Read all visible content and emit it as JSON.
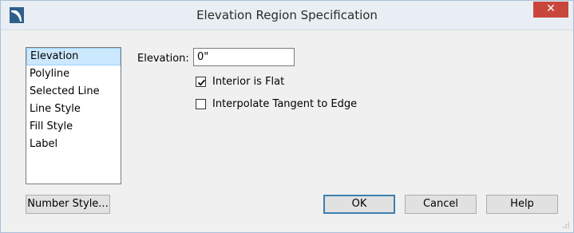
{
  "window": {
    "title": "Elevation Region Specification",
    "close_glyph": "✕",
    "app_icon": "app-logo-icon"
  },
  "sidebar": {
    "items": [
      {
        "label": "Elevation",
        "selected": true
      },
      {
        "label": "Polyline",
        "selected": false
      },
      {
        "label": "Selected Line",
        "selected": false
      },
      {
        "label": "Line Style",
        "selected": false
      },
      {
        "label": "Fill Style",
        "selected": false
      },
      {
        "label": "Label",
        "selected": false
      }
    ]
  },
  "form": {
    "elevation_label": "Elevation:",
    "elevation_value": "0\"",
    "interior_flat": {
      "label": "Interior is Flat",
      "checked": true
    },
    "interpolate_tangent": {
      "label": "Interpolate Tangent to Edge",
      "checked": false
    }
  },
  "buttons": {
    "number_style": "Number Style...",
    "ok": "OK",
    "cancel": "Cancel",
    "help": "Help"
  },
  "colors": {
    "close_button": "#c9463d",
    "selection": "#cce8ff",
    "default_button_border": "#3c7fb1"
  }
}
